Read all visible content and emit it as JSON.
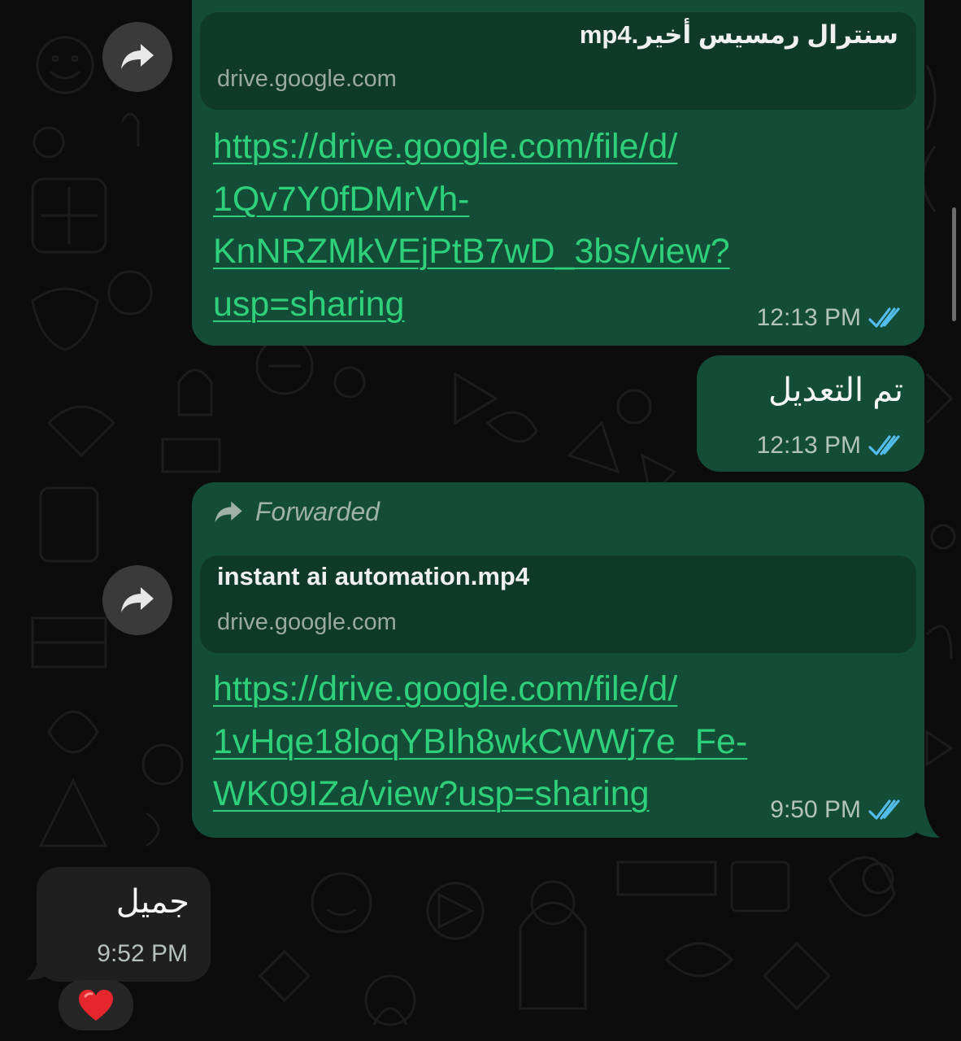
{
  "messages": [
    {
      "id": "m1",
      "preview_title": "سنترال رمسيس أخير.mp4",
      "preview_domain": "drive.google.com",
      "link_lines": [
        "https://drive.google.com/file/d/",
        "1Qv7Y0fDMrVh-",
        "KnNRZMkVEjPtB7wD_3bs/view?",
        "usp=sharing"
      ],
      "time": "12:13 PM"
    },
    {
      "id": "m2",
      "text": "تم التعديل",
      "time": "12:13 PM"
    },
    {
      "id": "m3",
      "forwarded_label": "Forwarded",
      "preview_title": "instant ai automation.mp4",
      "preview_domain": "drive.google.com",
      "link_lines": [
        "https://drive.google.com/file/d/",
        "1vHqe18loqYBIh8wkCWWj7e_Fe-",
        "WK09IZa/view?usp=sharing"
      ],
      "time": "9:50 PM"
    },
    {
      "id": "m4",
      "text": "جميل",
      "time": "9:52 PM",
      "reaction": "❤️"
    }
  ],
  "icons": {
    "forward": "share-forward-icon",
    "read_receipt": "double-check-icon",
    "reaction": "red-heart-icon"
  },
  "colors": {
    "outgoing_bubble": "#144d37",
    "incoming_bubble": "#1f1f1f",
    "link": "#2fd07a",
    "read_ticks": "#53bdeb"
  }
}
